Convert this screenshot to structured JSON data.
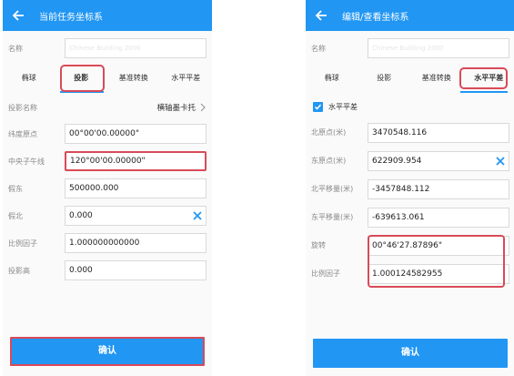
{
  "left": {
    "title": "当前任务坐标系",
    "name_label": "名称",
    "name_placeholder": "Chinese Building 2000",
    "tabs": [
      "椭球",
      "投影",
      "基准转换",
      "水平平差"
    ],
    "active_tab_index": 1,
    "projection_name_label": "投影名称",
    "projection_name_value": "横轴墨卡托",
    "fields": [
      {
        "label": "纬度原点",
        "value": "00°00'00.00000\""
      },
      {
        "label": "中央子午线",
        "value": "120°00'00.00000\""
      },
      {
        "label": "假东",
        "value": "500000.000"
      },
      {
        "label": "假北",
        "value": "0.000"
      },
      {
        "label": "比例因子",
        "value": "1.000000000000"
      },
      {
        "label": "投影高",
        "value": "0.000"
      }
    ],
    "confirm_label": "确认"
  },
  "right": {
    "title": "编辑/查看坐标系",
    "name_label": "名称",
    "name_placeholder": "Chinese Building 2000",
    "tabs": [
      "椭球",
      "投影",
      "基准转换",
      "水平平差"
    ],
    "active_tab_index": 3,
    "checkbox_label": "水平平差",
    "checkbox_checked": true,
    "fields": [
      {
        "label": "北原点(米)",
        "value": "3470548.116"
      },
      {
        "label": "东原点(米)",
        "value": "622909.954"
      },
      {
        "label": "北平移量(米)",
        "value": "-3457848.112"
      },
      {
        "label": "东平移量(米)",
        "value": "-639613.061"
      },
      {
        "label": "旋转",
        "value": "00°46'27.87896\""
      },
      {
        "label": "比例因子",
        "value": "1.000124582955"
      }
    ],
    "confirm_label": "确认"
  },
  "colors": {
    "primary": "#2196f3",
    "highlight": "#d94a57",
    "clear_icon": "#2196f3"
  }
}
